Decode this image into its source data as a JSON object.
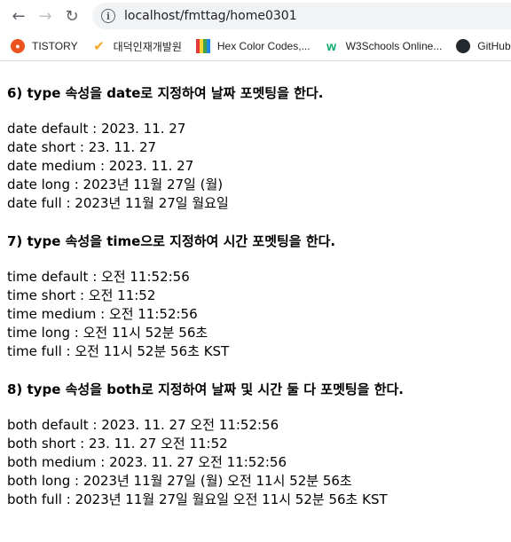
{
  "browser": {
    "url": "localhost/fmttag/home0301",
    "bookmarks": [
      {
        "label": "TISTORY",
        "icon": "tistory-icon"
      },
      {
        "label": "대덕인재개발원",
        "icon": "daedeok-icon"
      },
      {
        "label": "Hex Color Codes,...",
        "icon": "hex-color-icon"
      },
      {
        "label": "W3Schools Online...",
        "icon": "w3schools-icon"
      },
      {
        "label": "GitHub",
        "icon": "github-icon"
      }
    ]
  },
  "sections": [
    {
      "heading": "6) type 속성을 date로 지정하여 날짜 포멧팅을 한다.",
      "lines": [
        "date default : 2023. 11. 27",
        "date short : 23. 11. 27",
        "date medium : 2023. 11. 27",
        "date long : 2023년 11월 27일 (월)",
        "date full : 2023년 11월 27일 월요일"
      ]
    },
    {
      "heading": "7) type 속성을 time으로 지정하여 시간 포멧팅을 한다.",
      "lines": [
        "time default : 오전 11:52:56",
        "time short : 오전 11:52",
        "time medium : 오전 11:52:56",
        "time long : 오전 11시 52분 56초",
        "time full : 오전 11시 52분 56초 KST"
      ]
    },
    {
      "heading": "8) type 속성을 both로 지정하여 날짜 및 시간 둘 다 포멧팅을 한다.",
      "lines": [
        "both default : 2023. 11. 27 오전 11:52:56",
        "both short : 23. 11. 27 오전 11:52",
        "both medium : 2023. 11. 27 오전 11:52:56",
        "both long : 2023년 11월 27일 (월) 오전 11시 52분 56초",
        "both full : 2023년 11월 27일 월요일 오전 11시 52분 56초 KST"
      ]
    }
  ]
}
